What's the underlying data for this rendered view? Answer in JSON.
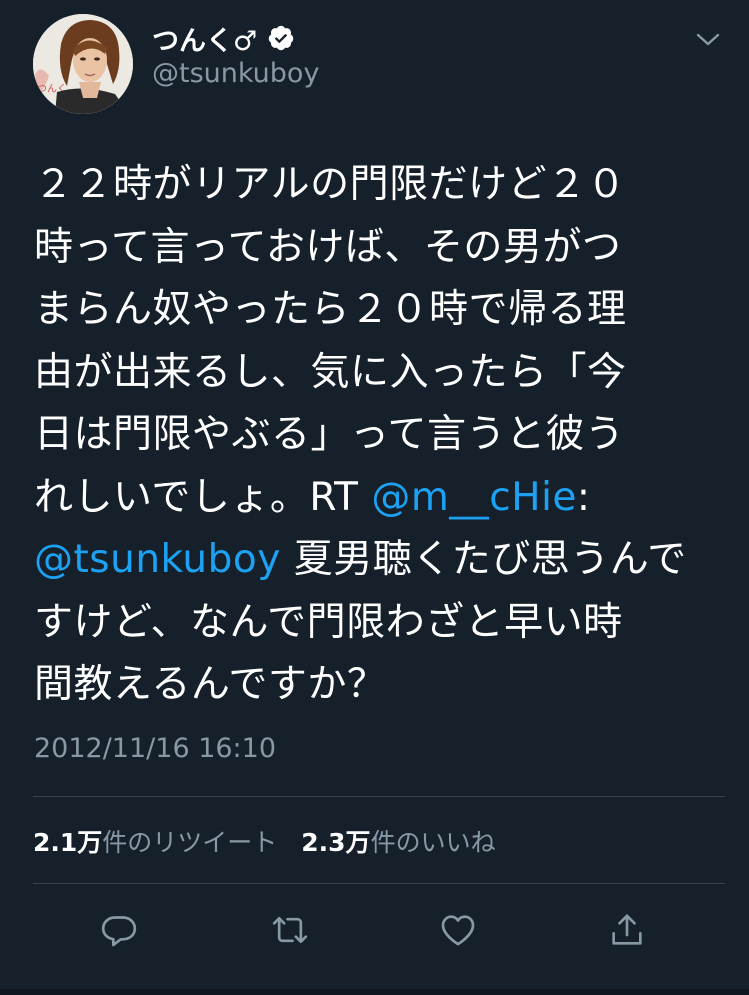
{
  "user": {
    "display_name": "つんく♂",
    "handle": "@tsunkuboy",
    "verified": true,
    "avatar_icon": "profile-photo"
  },
  "tweet": {
    "lines": [
      [
        {
          "text": "２２時がリアルの門限だけど２０",
          "mention": false
        }
      ],
      [
        {
          "text": "時って言っておけば、その男がつ",
          "mention": false
        }
      ],
      [
        {
          "text": "まらん奴やったら２０時で帰る理",
          "mention": false
        }
      ],
      [
        {
          "text": "由が出来るし、気に入ったら「今",
          "mention": false
        }
      ],
      [
        {
          "text": "日は門限やぶる」って言うと彼う",
          "mention": false
        }
      ],
      [
        {
          "text": "れしいでしょ。RT ",
          "mention": false
        },
        {
          "text": "@m__cHie",
          "mention": true
        },
        {
          "text": ":",
          "mention": false
        }
      ],
      [
        {
          "text": "@tsunkuboy",
          "mention": true
        },
        {
          "text": " 夏男聴くたび思うんで",
          "mention": false
        }
      ],
      [
        {
          "text": "すけど、なんで門限わざと早い時",
          "mention": false
        }
      ],
      [
        {
          "text": "間教えるんですか？",
          "mention": false
        }
      ]
    ],
    "timestamp": "2012/11/16 16:10"
  },
  "stats": {
    "retweets_count": "2.1万",
    "retweets_label": "件のリツイート",
    "likes_count": "2.3万",
    "likes_label": "件のいいね"
  },
  "actions": [
    {
      "name": "reply-button",
      "icon": "reply-icon"
    },
    {
      "name": "retweet-button",
      "icon": "retweet-icon"
    },
    {
      "name": "like-button",
      "icon": "heart-icon"
    },
    {
      "name": "share-button",
      "icon": "share-icon"
    }
  ],
  "colors": {
    "background": "#15202b",
    "text": "#ffffff",
    "secondary": "#8899a6",
    "link": "#1da1f2",
    "divider": "#38444d"
  }
}
